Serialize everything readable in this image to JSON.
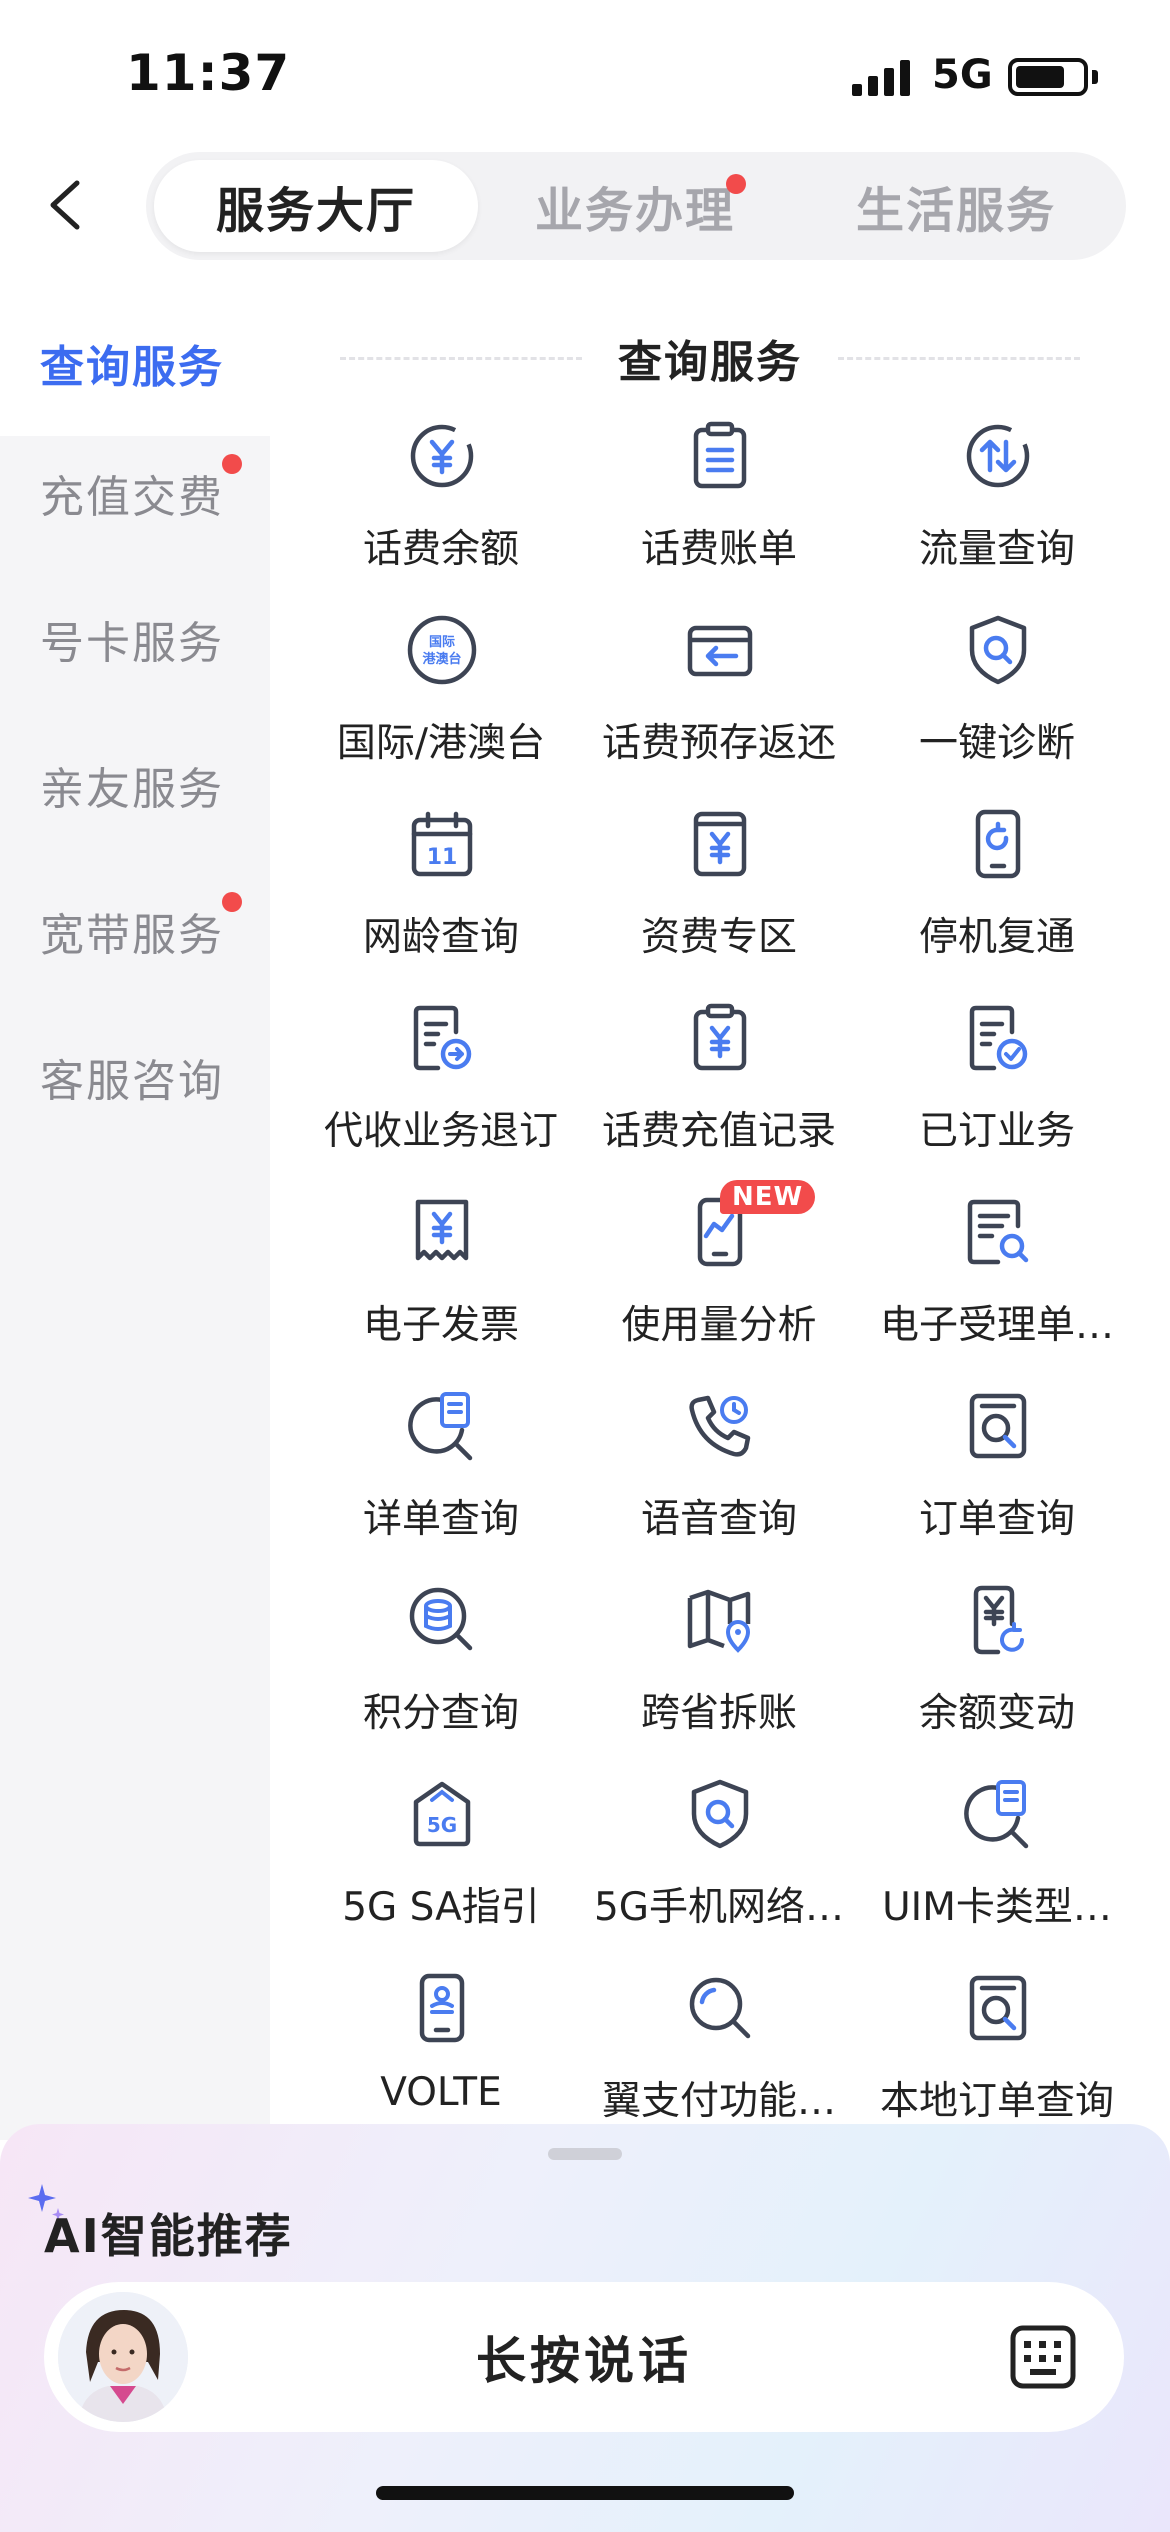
{
  "status_bar": {
    "time": "11:37",
    "network": "5G",
    "battery_level": 0.7
  },
  "header": {
    "tabs": [
      {
        "label": "服务大厅",
        "active": true
      },
      {
        "label": "业务办理",
        "active": false,
        "badge_dot": true
      },
      {
        "label": "生活服务",
        "active": false
      }
    ]
  },
  "sidebar": {
    "items": [
      {
        "label": "查询服务",
        "active": true
      },
      {
        "label": "充值交费",
        "badge_dot": true
      },
      {
        "label": "号卡服务"
      },
      {
        "label": "亲友服务"
      },
      {
        "label": "宽带服务",
        "badge_dot": true
      },
      {
        "label": "客服咨询"
      }
    ]
  },
  "main": {
    "section_title": "查询服务",
    "items": [
      {
        "label": "话费余额",
        "icon": "yuan-circle-icon"
      },
      {
        "label": "话费账单",
        "icon": "clipboard-list-icon"
      },
      {
        "label": "流量查询",
        "icon": "updown-arrows-circle-icon"
      },
      {
        "label": "国际/港澳台",
        "icon": "international-badge-icon",
        "icon_text": [
          "国际",
          "港澳台"
        ]
      },
      {
        "label": "话费预存返还",
        "icon": "card-return-icon"
      },
      {
        "label": "一键诊断",
        "icon": "shield-search-icon"
      },
      {
        "label": "网龄查询",
        "icon": "calendar-icon",
        "icon_text": [
          "11"
        ]
      },
      {
        "label": "资费专区",
        "icon": "yuan-document-icon"
      },
      {
        "label": "停机复通",
        "icon": "phone-restore-icon"
      },
      {
        "label": "代收业务退订",
        "icon": "doc-arrow-icon"
      },
      {
        "label": "话费充值记录",
        "icon": "clipboard-yuan-icon"
      },
      {
        "label": "已订业务",
        "icon": "doc-check-icon"
      },
      {
        "label": "电子发票",
        "icon": "receipt-yuan-icon"
      },
      {
        "label": "使用量分析",
        "icon": "phone-chart-icon",
        "badge": "NEW"
      },
      {
        "label": "电子受理单…",
        "icon": "doc-search-icon"
      },
      {
        "label": "详单查询",
        "icon": "magnifier-doc-icon"
      },
      {
        "label": "语音查询",
        "icon": "phone-clock-icon"
      },
      {
        "label": "订单查询",
        "icon": "frame-search-icon"
      },
      {
        "label": "积分查询",
        "icon": "coins-search-icon"
      },
      {
        "label": "跨省拆账",
        "icon": "map-pin-icon"
      },
      {
        "label": "余额变动",
        "icon": "phone-yuan-icon"
      },
      {
        "label": "5G SA指引",
        "icon": "house-5g-icon",
        "icon_text": [
          "5G"
        ]
      },
      {
        "label": "5G手机网络…",
        "icon": "shield-search-icon"
      },
      {
        "label": "UIM卡类型…",
        "icon": "magnifier-doc-icon"
      },
      {
        "label": "VOLTE",
        "icon": "phone-id-icon"
      },
      {
        "label": "翼支付功能…",
        "icon": "search-icon"
      },
      {
        "label": "本地订单查询",
        "icon": "frame-search-icon"
      }
    ]
  },
  "ai_panel": {
    "title": "AI智能推荐",
    "voice_label": "长按说话"
  },
  "colors": {
    "accent": "#3c6cf0",
    "icon_stroke": "#3d4454",
    "badge": "#f24b4b"
  }
}
